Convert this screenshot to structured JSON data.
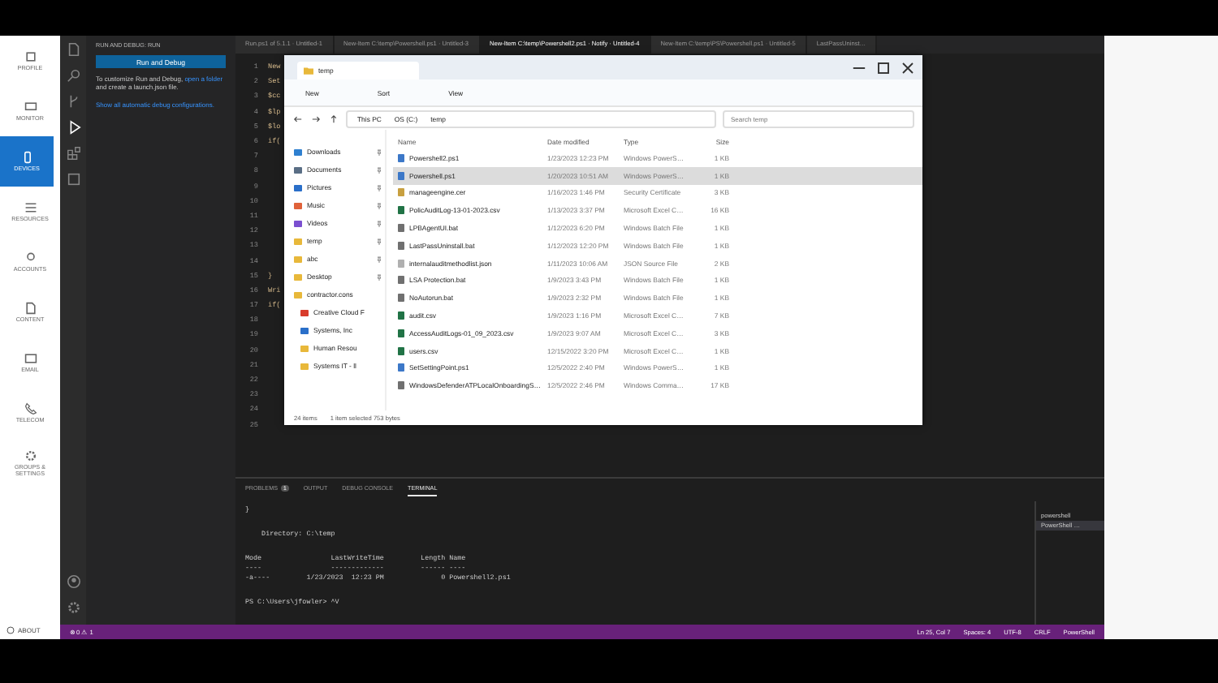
{
  "nav": {
    "items": [
      {
        "label": "PROFILE",
        "selected": false
      },
      {
        "label": "MONITOR",
        "selected": false
      },
      {
        "label": "DEVICES",
        "selected": true
      },
      {
        "label": "RESOURCES",
        "selected": false
      },
      {
        "label": "ACCOUNTS",
        "selected": false
      },
      {
        "label": "CONTENT",
        "selected": false
      },
      {
        "label": "EMAIL",
        "selected": false
      },
      {
        "label": "TELECOM",
        "selected": false
      },
      {
        "label": "GROUPS & SETTINGS",
        "selected": false
      }
    ],
    "about": "ABOUT"
  },
  "activity_bar": {
    "items": [
      {
        "kind": "files",
        "selected": false
      },
      {
        "kind": "search",
        "selected": false
      },
      {
        "kind": "branch",
        "selected": false
      },
      {
        "kind": "run",
        "selected": true
      },
      {
        "kind": "extensions",
        "selected": false
      },
      {
        "kind": "remote",
        "selected": false
      }
    ]
  },
  "sidebar": {
    "title": "RUN AND DEBUG: RUN",
    "button": "Run and Debug",
    "paragraph": [
      {
        "text": "To customize Run and Debug, ",
        "link": false
      },
      {
        "text": "open a folder",
        "link": true
      },
      {
        "text": " and create a launch.json file.",
        "link": false
      }
    ],
    "show_all_link": "Show all automatic debug configurations."
  },
  "editor": {
    "tabs": [
      {
        "label": "Run.ps1 of 5.1.1 · Untitled-1",
        "selected": false
      },
      {
        "label": "New-Item C:\\temp\\Powershell.ps1 · Untitled-3",
        "selected": false
      },
      {
        "label": "New-Item C:\\temp\\Powershell2.ps1 · Notify · Untitled-4",
        "selected": true
      },
      {
        "label": "New-Item C:\\temp\\PS\\Powershell.ps1 · Untitled-5",
        "selected": false
      },
      {
        "label": "LastPassUninst…",
        "selected": false
      }
    ],
    "lines": [
      {
        "number": "1",
        "code": "New"
      },
      {
        "number": "2",
        "code": "Set"
      },
      {
        "number": "3",
        "code": "$cc"
      },
      {
        "number": "4",
        "code": "$lp"
      },
      {
        "number": "5",
        "code": "$lo"
      },
      {
        "number": "6",
        "code": "if("
      },
      {
        "number": "7"
      },
      {
        "number": "8"
      },
      {
        "number": "9"
      },
      {
        "number": "10"
      },
      {
        "number": "11"
      },
      {
        "number": "12"
      },
      {
        "number": "13"
      },
      {
        "number": "14"
      },
      {
        "number": "15",
        "code": "}"
      },
      {
        "number": "16",
        "code": "Wri"
      },
      {
        "number": "17",
        "code": "if("
      },
      {
        "number": "18"
      },
      {
        "number": "19"
      },
      {
        "number": "20"
      },
      {
        "number": "21"
      },
      {
        "number": "22"
      },
      {
        "number": "23"
      },
      {
        "number": "24"
      },
      {
        "number": "25"
      }
    ]
  },
  "explorer": {
    "tab": "temp",
    "toolbar": [
      "New",
      "Sort",
      "View"
    ],
    "path": [
      "This PC",
      "OS (C:)",
      "temp"
    ],
    "search": {
      "placeholder": "Search temp"
    },
    "nav": [
      {
        "label": "Downloads",
        "color": "#2f80d0",
        "pinned": true,
        "group": false
      },
      {
        "label": "Documents",
        "color": "#5a6e85",
        "pinned": true,
        "group": false
      },
      {
        "label": "Pictures",
        "color": "#2a6fc9",
        "pinned": true,
        "group": false
      },
      {
        "label": "Music",
        "color": "#e0623a",
        "pinned": true,
        "group": false
      },
      {
        "label": "Videos",
        "color": "#7b4fd0",
        "pinned": true,
        "group": false
      },
      {
        "label": "temp",
        "color": "#e8b83a",
        "pinned": true,
        "group": false
      },
      {
        "label": "abc",
        "color": "#e8b83a",
        "pinned": true,
        "group": false
      },
      {
        "label": "Desktop",
        "color": "#e8b83a",
        "pinned": true,
        "group": false
      },
      {
        "label": "contractor.cons",
        "color": "#e8b83a",
        "pinned": false,
        "group": false
      },
      {
        "label": "Creative Cloud F",
        "color": "#d83b2b",
        "pinned": false,
        "group": true
      },
      {
        "label": "Systems, Inc",
        "color": "#2a6fc9",
        "pinned": false,
        "group": true
      },
      {
        "label": "Human Resou",
        "color": "#e8b83a",
        "pinned": false,
        "group": true
      },
      {
        "label": "Systems IT - ll",
        "color": "#e8b83a",
        "pinned": false,
        "group": true
      }
    ],
    "columns": [
      "Name",
      "Date modified",
      "Type",
      "Size"
    ],
    "rows": [
      {
        "name": "Powershell2.ps1",
        "date": "1/23/2023 12:23 PM",
        "type": "Windows PowerS…",
        "size": "1 KB",
        "color": "#3c78c8",
        "selected": false
      },
      {
        "name": "Powershell.ps1",
        "date": "1/20/2023 10:51 AM",
        "type": "Windows PowerS…",
        "size": "1 KB",
        "color": "#3c78c8",
        "selected": true
      },
      {
        "name": "manageengine.cer",
        "date": "1/16/2023 1:46 PM",
        "type": "Security Certificate",
        "size": "3 KB",
        "color": "#c8a040",
        "selected": false
      },
      {
        "name": "PolicAuditLog-13-01-2023.csv",
        "date": "1/13/2023 3:37 PM",
        "type": "Microsoft Excel C…",
        "size": "16 KB",
        "color": "#217346",
        "selected": false
      },
      {
        "name": "LPBAgentUI.bat",
        "date": "1/12/2023 6:20 PM",
        "type": "Windows Batch File",
        "size": "1 KB",
        "color": "#707070",
        "selected": false
      },
      {
        "name": "LastPassUninstall.bat",
        "date": "1/12/2023 12:20 PM",
        "type": "Windows Batch File",
        "size": "1 KB",
        "color": "#707070",
        "selected": false
      },
      {
        "name": "internalauditmethodlist.json",
        "date": "1/11/2023 10:06 AM",
        "type": "JSON Source File",
        "size": "2 KB",
        "color": "#b0b0b0",
        "selected": false
      },
      {
        "name": "LSA Protection.bat",
        "date": "1/9/2023 3:43 PM",
        "type": "Windows Batch File",
        "size": "1 KB",
        "color": "#707070",
        "selected": false
      },
      {
        "name": "NoAutorun.bat",
        "date": "1/9/2023 2:32 PM",
        "type": "Windows Batch File",
        "size": "1 KB",
        "color": "#707070",
        "selected": false
      },
      {
        "name": "audit.csv",
        "date": "1/9/2023 1:16 PM",
        "type": "Microsoft Excel C…",
        "size": "7 KB",
        "color": "#217346",
        "selected": false
      },
      {
        "name": "AccessAuditLogs-01_09_2023.csv",
        "date": "1/9/2023 9:07 AM",
        "type": "Microsoft Excel C…",
        "size": "3 KB",
        "color": "#217346",
        "selected": false
      },
      {
        "name": "users.csv",
        "date": "12/15/2022 3:20 PM",
        "type": "Microsoft Excel C…",
        "size": "1 KB",
        "color": "#217346",
        "selected": false
      },
      {
        "name": "SetSettingPoint.ps1",
        "date": "12/5/2022 2:40 PM",
        "type": "Windows PowerS…",
        "size": "1 KB",
        "color": "#3c78c8",
        "selected": false
      },
      {
        "name": "WindowsDefenderATPLocalOnboardingS…",
        "date": "12/5/2022 2:46 PM",
        "type": "Windows Comma…",
        "size": "17 KB",
        "color": "#707070",
        "selected": false
      }
    ],
    "status": [
      "24 items",
      "1 item selected  753 bytes"
    ]
  },
  "panel": {
    "tabs": [
      {
        "label": "PROBLEMS",
        "badge": "1",
        "selected": false
      },
      {
        "label": "OUTPUT",
        "selected": false
      },
      {
        "label": "DEBUG CONSOLE",
        "selected": false
      },
      {
        "label": "TERMINAL",
        "selected": true
      }
    ],
    "blocks": [
      [
        "}"
      ],
      [
        "    Directory: C:\\temp"
      ],
      [
        "Mode                 LastWriteTime         Length Name",
        "----                 -------------         ------ ----",
        "-a----         1/23/2023  12:23 PM              0 Powershell2.ps1"
      ]
    ],
    "prompt": "PS C:\\Users\\jfowler> ^V",
    "terminals": [
      {
        "label": "powershell",
        "selected": false
      },
      {
        "label": "PowerShell …",
        "selected": true
      }
    ]
  },
  "status_bar": {
    "problems": "⊗ 0 ⚠ 1",
    "items": [
      "Ln 25, Col 7",
      "Spaces: 4",
      "UTF-8",
      "CRLF",
      "PowerShell"
    ]
  }
}
